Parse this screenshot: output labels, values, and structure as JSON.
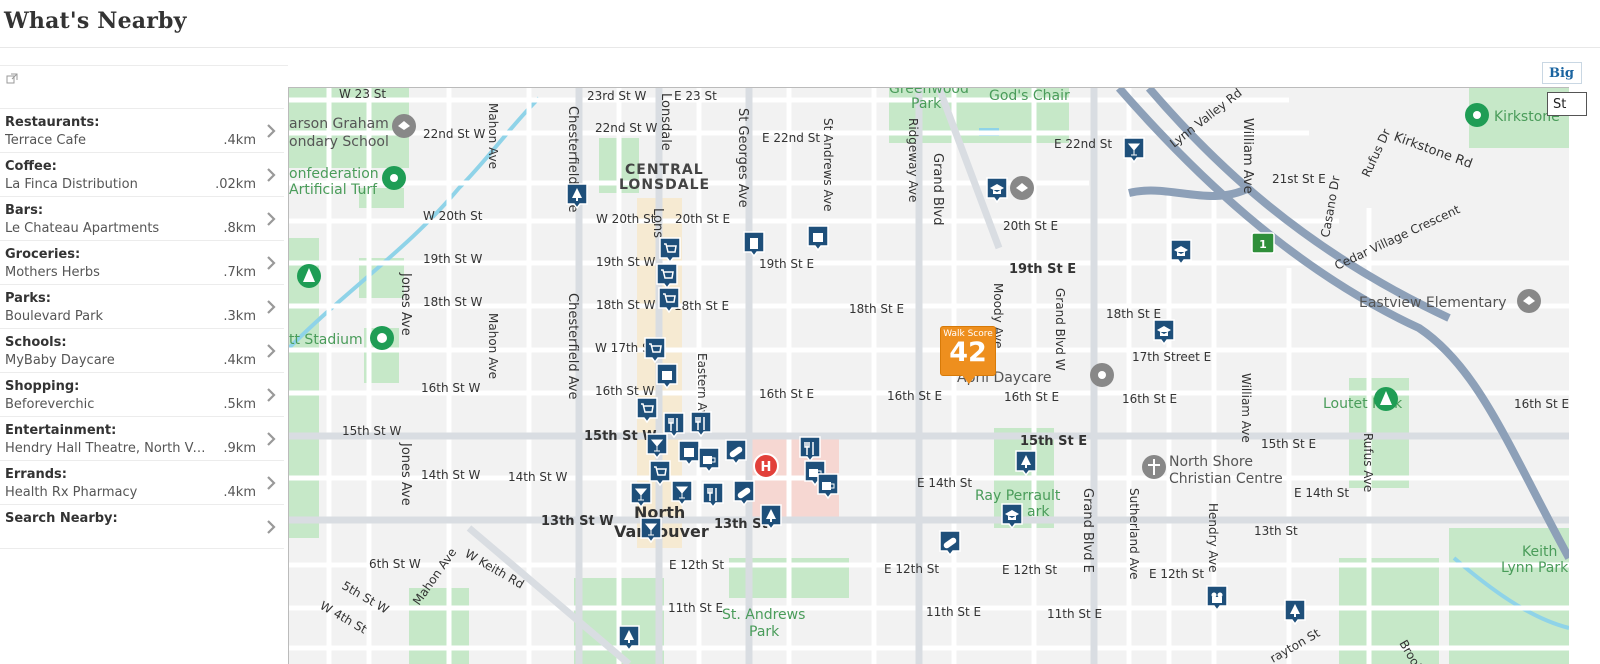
{
  "header": {
    "title": "What's Nearby"
  },
  "sidebar": {
    "items": [
      {
        "category": "Restaurants:",
        "place": "Terrace Cafe",
        "distance": ".4km"
      },
      {
        "category": "Coffee:",
        "place": "La Finca Distribution",
        "distance": ".02km"
      },
      {
        "category": "Bars:",
        "place": "Le Chateau Apartments",
        "distance": ".8km"
      },
      {
        "category": "Groceries:",
        "place": "Mothers Herbs",
        "distance": ".7km"
      },
      {
        "category": "Parks:",
        "place": "Boulevard Park",
        "distance": ".3km"
      },
      {
        "category": "Schools:",
        "place": "MyBaby Daycare",
        "distance": ".4km"
      },
      {
        "category": "Shopping:",
        "place": "Beforeverchic",
        "distance": ".5km"
      },
      {
        "category": "Entertainment:",
        "place": "Hendry Hall Theatre, North Va...",
        "distance": ".9km"
      },
      {
        "category": "Errands:",
        "place": "Health Rx Pharmacy",
        "distance": ".4km"
      },
      {
        "category": "Search Nearby:",
        "place": "",
        "distance": ""
      }
    ]
  },
  "map": {
    "big_button_label": "Big",
    "street_view_label": "St",
    "walk_score": {
      "label": "Walk Score",
      "value": "42"
    },
    "street_labels": {
      "w23": "W 23 St",
      "st23w": "23rd St W",
      "e23": "E 23 St",
      "w22": "22nd St W",
      "st22w": "22nd St W",
      "e22a": "E 22nd St",
      "e22b": "E 22nd St",
      "w20": "W 20th St",
      "w20b": "W 20th St",
      "st20e": "20th St E",
      "st20e_b": "20th St E",
      "st19w": "19th St W",
      "st19wb": "19th St W",
      "st19e": "19th St E",
      "st19e_b": "19th St E",
      "st18w": "18th St W",
      "st18wb": "18th St W",
      "st18e": "18th St E",
      "st18e_b": "18th St E",
      "st18e_c": "18th St E",
      "w17": "W 17th St",
      "st17e": "17th Street E",
      "st16w": "16th St W",
      "st16wb": "16th St W",
      "st16e": "16th St E",
      "st16e_b": "16th St E",
      "st16e_c": "16th St E",
      "st16e_d": "16th St E",
      "st16e_e": "16th St E",
      "st15w": "15th St W",
      "st15wb": "15th St W",
      "st15e": "15th St E",
      "st15e_b": "15th St E",
      "st14w": "14th St W",
      "st14wb": "14th St W",
      "e14": "E 14th St",
      "e14b": "E 14th St",
      "st13w": "13th St W",
      "st13e": "13th St",
      "st13e_b": "13th St",
      "st6w": "6th St W",
      "st5w": "5th St W",
      "w4": "W 4th St",
      "wkeith": "W Keith Rd",
      "e12a": "E 12th St",
      "e12b": "E 12th St",
      "e12c": "E 12th St",
      "e12d": "E 12th St",
      "st11e": "11th St E",
      "st11e_b": "11th St E",
      "st11e_c": "11th St E",
      "st21e": "21st St E",
      "kirkstone": "Kirkstone Rd",
      "cedar": "Cedar Village Crescent",
      "lynnvalley": "Lynn Valley Rd",
      "grandblvd": "Grand Blvd",
      "grandblvdw": "Grand Blvd W",
      "grandblvde": "Grand Blvd E",
      "moody": "Moody Ave",
      "ridgeway": "Ridgeway Ave",
      "standrews": "St Andrews Ave",
      "stgeorges": "St Georges Ave",
      "lonsdale": "Lonsdale",
      "lonsdale2": "Lons",
      "eastern": "Eastern Ave",
      "chesterfield": "Chesterfield Ave",
      "chesterfield2": "Chesterfield Ave",
      "mahon": "Mahon Ave",
      "mahon2": "Mahon Ave",
      "mahon3": "Mahon Ave",
      "jones": "Jones Ave",
      "jones2": "Jones Ave",
      "william": "William Ave",
      "william2": "William Ave",
      "sutherland": "Sutherland Ave",
      "hendry": "Hendry Ave",
      "rufus": "Rufus Ave",
      "rufusdr": "Rufus Dr",
      "casano": "Casano Dr",
      "brooks": "Brooks",
      "crayton": "rayton St"
    },
    "place_labels": {
      "greenwood": "Greenwood",
      "park": "Park",
      "godschair": "God's Chair",
      "carson": "arson Graham",
      "condary": "ondary School",
      "confed": "onfederation",
      "artificial": "Artificial Turf",
      "central": "CENTRAL",
      "lonsdalenb": "LONSDALE",
      "stadium": "tt Stadium",
      "aprildaycare": "April Daycare",
      "kirkstonepark": "Kirkstone",
      "eastview": "Eastview Elementary",
      "loutet": "Loutet Park",
      "northshore": "North Shore",
      "christian": "Christian Centre",
      "rayperrault": "Ray Perrault",
      "ark": "ark",
      "north": "North",
      "vancouver": "Vancouver",
      "standrewspark": "St. Andrews",
      "park2": "Park",
      "keith": "Keith",
      "lynnpark": "Lynn Park"
    },
    "highway_shield": "1"
  },
  "colors": {
    "map_bg": "#f2f2f2",
    "street": "#ffffff",
    "major_road": "#d9dde2",
    "highway": "#8da0b8",
    "park": "#c6e8c8",
    "water": "#8fd3e8",
    "marker": "#1e4f7a",
    "walk_score": "#ee8f1e",
    "hospital_zone": "#f6d7d2",
    "hospital": "#e2403a",
    "green_pin": "#1f9d55"
  }
}
